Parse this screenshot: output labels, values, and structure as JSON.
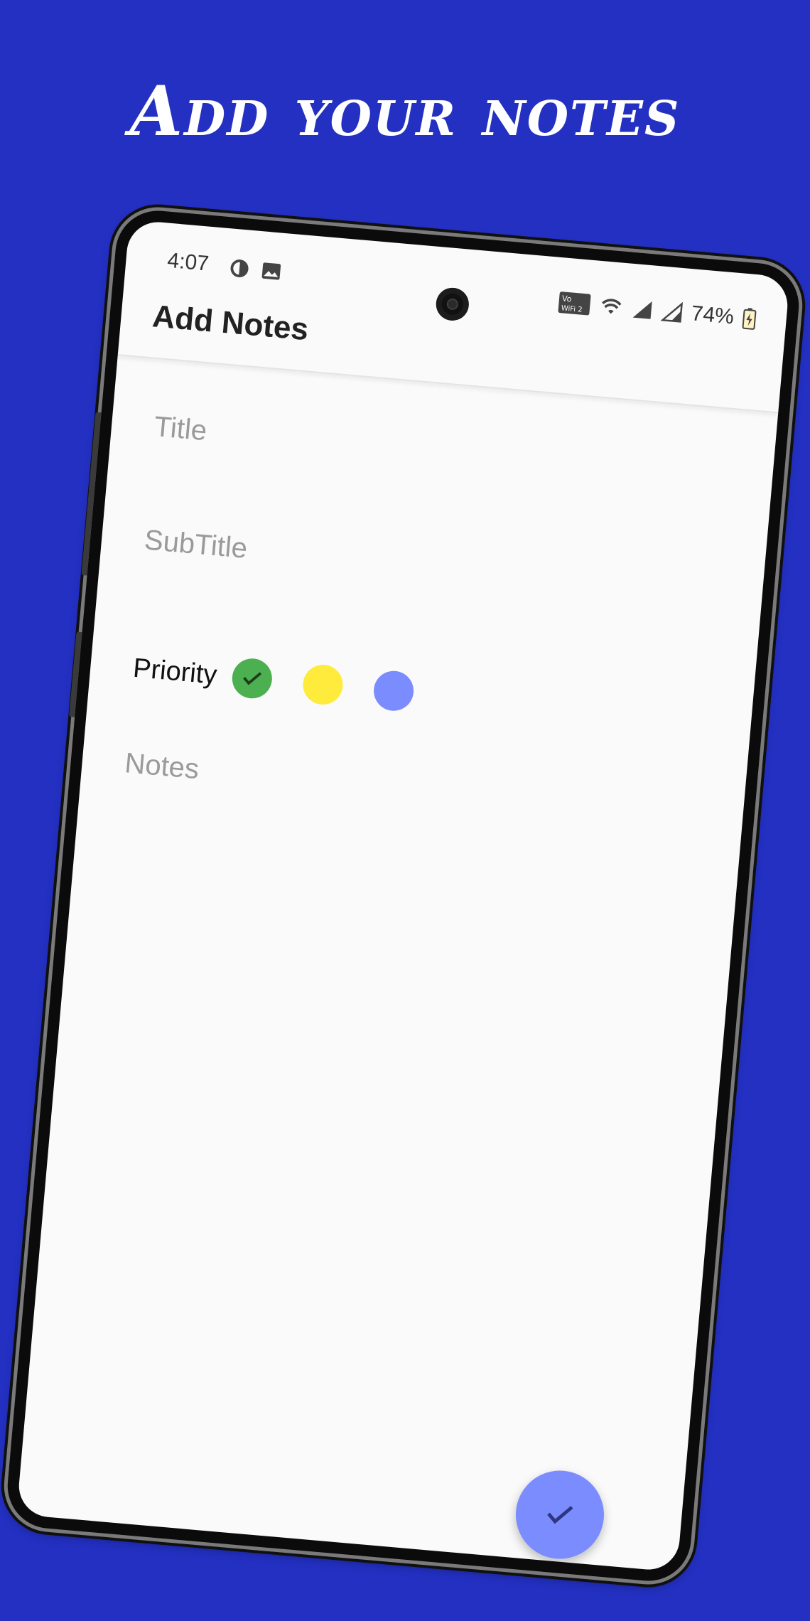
{
  "banner": {
    "headline": "Add your notes"
  },
  "status_bar": {
    "time": "4:07",
    "battery": "74%",
    "wifi_label": "Vo WiFi 2"
  },
  "app_bar": {
    "title": "Add Notes"
  },
  "form": {
    "title_placeholder": "Title",
    "subtitle_placeholder": "SubTitle",
    "priority_label": "Priority",
    "notes_placeholder": "Notes",
    "priority_options": [
      {
        "name": "green",
        "color": "#4caf50",
        "selected": true
      },
      {
        "name": "yellow",
        "color": "#ffeb3b",
        "selected": false
      },
      {
        "name": "blue",
        "color": "#7b8cff",
        "selected": false
      }
    ]
  },
  "fab": {
    "icon": "check-icon",
    "color": "#7b8cff"
  },
  "colors": {
    "background": "#2330c2",
    "screen": "#fafafa"
  }
}
